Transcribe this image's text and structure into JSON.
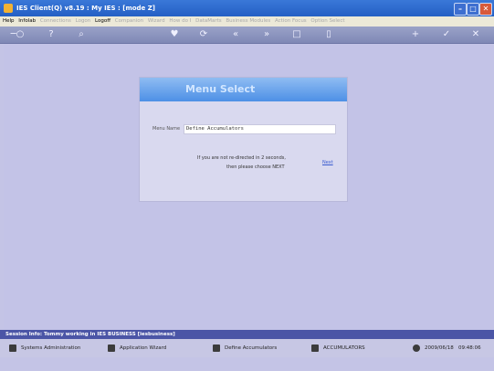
{
  "window": {
    "title": "IES Client(Q) v8.19 : My IES :      [mode Z]",
    "min_glyph": "–",
    "max_glyph": "□",
    "close_glyph": "✕"
  },
  "menubar": {
    "items": [
      {
        "label": "Help",
        "enabled": true
      },
      {
        "label": "Infolab",
        "enabled": true
      },
      {
        "label": "Connections",
        "enabled": false
      },
      {
        "label": "Logon",
        "enabled": false
      },
      {
        "label": "Logoff",
        "enabled": true
      },
      {
        "label": "Companion",
        "enabled": false
      },
      {
        "label": "Wizard",
        "enabled": false
      },
      {
        "label": "How do I",
        "enabled": false
      },
      {
        "label": "DataMarts",
        "enabled": false
      },
      {
        "label": "Business Modules",
        "enabled": false
      },
      {
        "label": "Action Focus",
        "enabled": false
      },
      {
        "label": "Option Select",
        "enabled": false
      }
    ]
  },
  "toolbar": {
    "icons": [
      {
        "name": "key-icon",
        "glyph": "─○"
      },
      {
        "name": "help-icon",
        "glyph": "?"
      },
      {
        "name": "search-icon",
        "glyph": "⌕"
      },
      {
        "name": "heart-icon",
        "glyph": "♥"
      },
      {
        "name": "refresh-icon",
        "glyph": "⟳"
      },
      {
        "name": "back-icon",
        "glyph": "«"
      },
      {
        "name": "forward-icon",
        "glyph": "»"
      },
      {
        "name": "window-icon",
        "glyph": "□"
      },
      {
        "name": "document-icon",
        "glyph": "▯"
      },
      {
        "name": "add-icon",
        "glyph": "+"
      },
      {
        "name": "check-icon",
        "glyph": "✓"
      },
      {
        "name": "close-icon",
        "glyph": "✕"
      }
    ]
  },
  "dialog": {
    "title": "Menu Select",
    "menu_name_label": "Menu Name",
    "menu_name_value": "Define Accumulators",
    "message_line1": "If you are not re-directed in 2 seconds,",
    "message_line2": "then please choose NEXT",
    "next_link": "Next"
  },
  "session": {
    "info": "Session Info: Tommy working in IES BUSINESS  [iesbusiness]"
  },
  "taskbar": {
    "items": [
      {
        "label": "Systems Administration"
      },
      {
        "label": "Application Wizard"
      },
      {
        "label": "Define Accumulators"
      },
      {
        "label": "ACCUMULATORS"
      }
    ],
    "date": "2009/06/18",
    "time": "09:48:06"
  },
  "colors": {
    "titlebar": "#2f6ad0",
    "content_bg": "#c3c3e7",
    "dialog_header": "#5a96e8",
    "session_bar": "#4b55a6"
  }
}
